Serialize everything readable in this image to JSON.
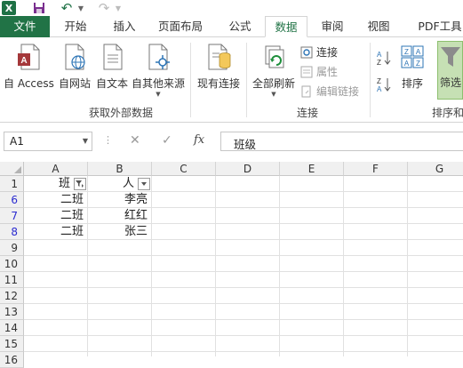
{
  "quick_access": {
    "app_icon": "X",
    "icons": [
      "excel-icon",
      "save-icon",
      "undo-icon",
      "redo-icon"
    ]
  },
  "tabs": [
    {
      "id": "file",
      "label": "文件"
    },
    {
      "id": "home",
      "label": "开始"
    },
    {
      "id": "insert",
      "label": "插入"
    },
    {
      "id": "layout",
      "label": "页面布局"
    },
    {
      "id": "formula",
      "label": "公式"
    },
    {
      "id": "data",
      "label": "数据",
      "active": true
    },
    {
      "id": "review",
      "label": "审阅"
    },
    {
      "id": "view",
      "label": "视图"
    },
    {
      "id": "pdf",
      "label": "PDF工具"
    }
  ],
  "ribbon": {
    "get_external": {
      "access": "自 Access",
      "web": "自网站",
      "text": "自文本",
      "other": "自其他来源",
      "group_label": "获取外部数据"
    },
    "existing_connections": "现有连接",
    "connections": {
      "refresh_all": "全部刷新",
      "connections": "连接",
      "properties": "属性",
      "edit_links": "编辑链接",
      "group_label": "连接"
    },
    "sort_filter": {
      "sort": "排序",
      "filter": "筛选",
      "group_label": "排序和"
    }
  },
  "formula_bar": {
    "name_box": "A1",
    "fx": "fx",
    "formula": "班级"
  },
  "grid": {
    "columns": [
      "A",
      "B",
      "C",
      "D",
      "E",
      "F",
      "G"
    ],
    "rows": [
      {
        "num": "1",
        "filtered": false,
        "a": "班",
        "b": "人"
      },
      {
        "num": "6",
        "filtered": true,
        "a": "二班",
        "b": "李亮"
      },
      {
        "num": "7",
        "filtered": true,
        "a": "二班",
        "b": "红红"
      },
      {
        "num": "8",
        "filtered": true,
        "a": "二班",
        "b": "张三"
      },
      {
        "num": "9",
        "filtered": false,
        "a": "",
        "b": ""
      },
      {
        "num": "10",
        "filtered": false,
        "a": "",
        "b": ""
      },
      {
        "num": "11",
        "filtered": false,
        "a": "",
        "b": ""
      },
      {
        "num": "12",
        "filtered": false,
        "a": "",
        "b": ""
      },
      {
        "num": "13",
        "filtered": false,
        "a": "",
        "b": ""
      },
      {
        "num": "14",
        "filtered": false,
        "a": "",
        "b": ""
      },
      {
        "num": "15",
        "filtered": false,
        "a": "",
        "b": ""
      },
      {
        "num": "16",
        "filtered": false,
        "a": "",
        "b": ""
      }
    ]
  },
  "colors": {
    "excel_green": "#217346",
    "filtered_row_number": "#2b2bd0"
  }
}
